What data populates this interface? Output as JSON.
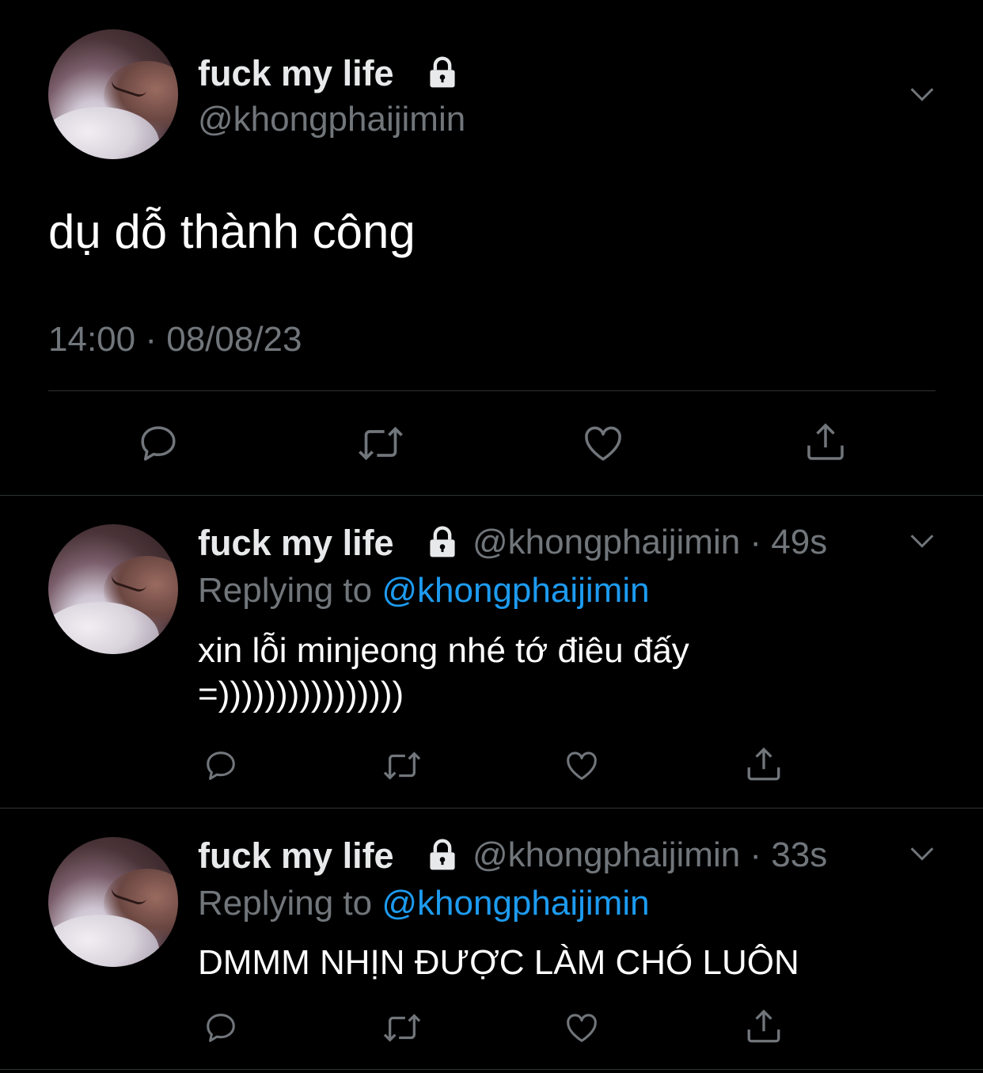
{
  "main_tweet": {
    "display_name": "fuck my life",
    "handle": "@khongphaijimin",
    "text": "dụ dỗ thành công",
    "time": "14:00",
    "date": "08/08/23"
  },
  "replies": [
    {
      "display_name": "fuck my life",
      "handle": "@khongphaijimin",
      "age": "49s",
      "replying_prefix": "Replying to",
      "replying_to": "@khongphaijimin",
      "text_line1": "xin lỗi minjeong nhé tớ điêu đấy",
      "text_line2": "=))))))))))))))))"
    },
    {
      "display_name": "fuck my life",
      "handle": "@khongphaijimin",
      "age": "33s",
      "replying_prefix": "Replying to",
      "replying_to": "@khongphaijimin",
      "text_line1": "DMMM NHỊN ĐƯỢC LÀM CHÓ LUÔN"
    }
  ],
  "icons": {
    "protected": "lock-icon",
    "more": "chevron-down-icon",
    "reply": "reply-icon",
    "retweet": "retweet-icon",
    "like": "heart-icon",
    "share": "share-icon"
  },
  "colors": {
    "background": "#000000",
    "text": "#e7e9ea",
    "secondary": "#71767b",
    "link": "#1d9bf0",
    "divider": "#2f3336"
  }
}
